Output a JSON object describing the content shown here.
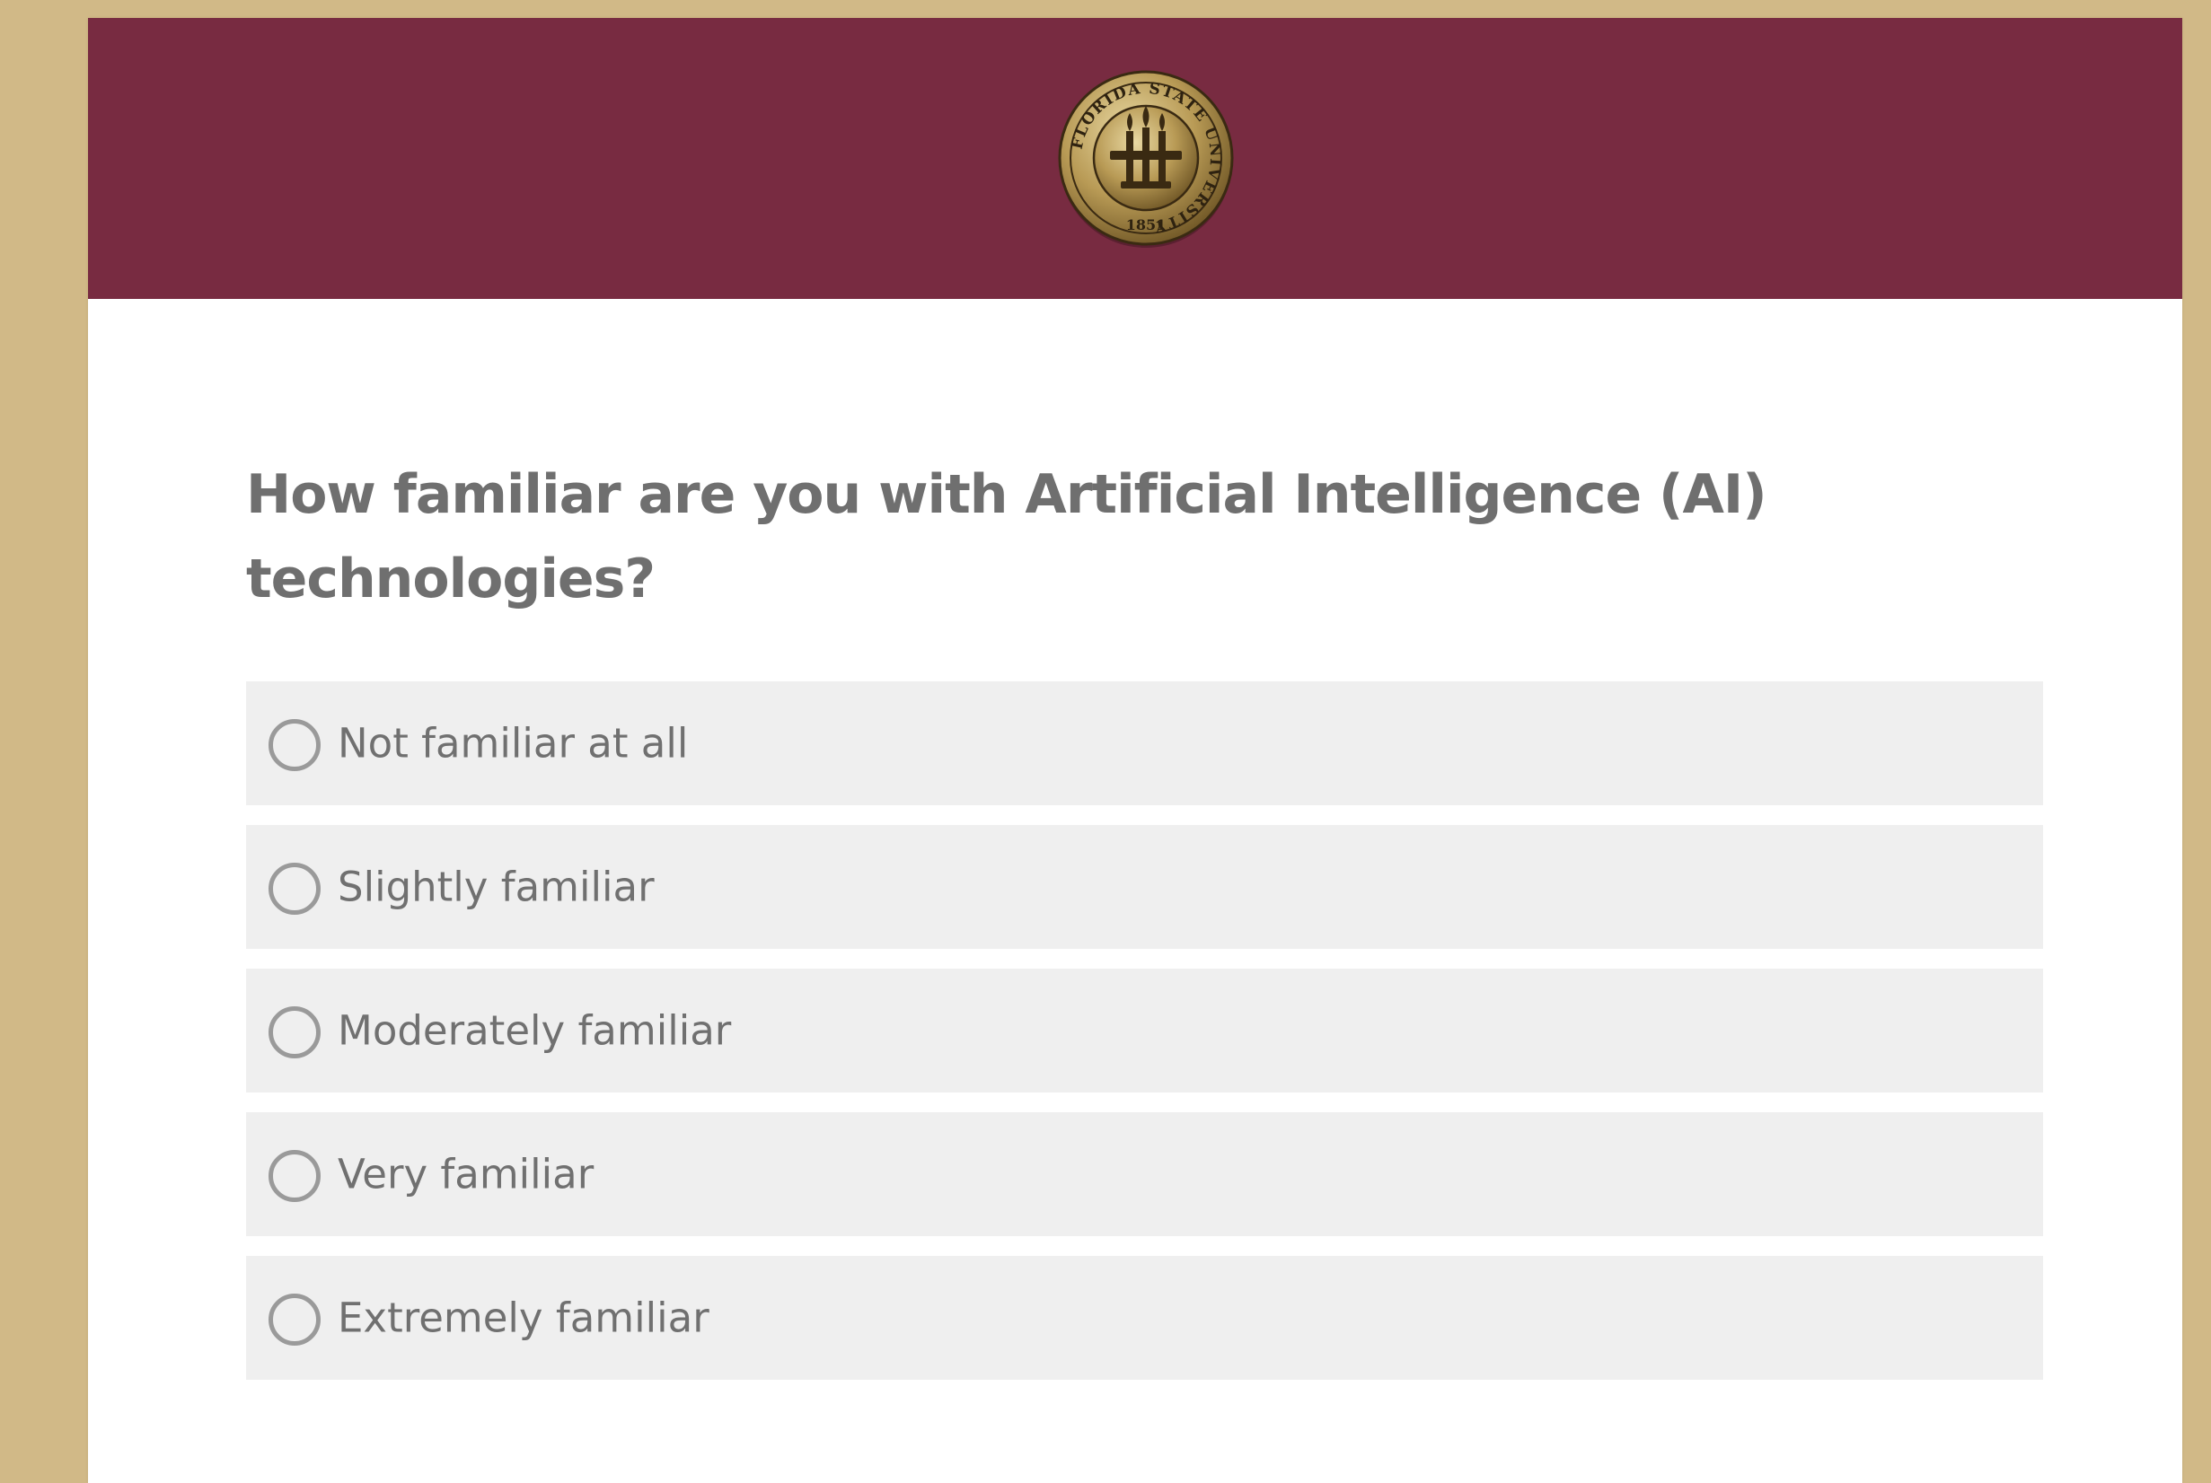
{
  "page": {
    "background_color": "#d1b987",
    "card_color": "#ffffff"
  },
  "header": {
    "background_color": "#782b41",
    "logo": {
      "icon": "university-seal-icon",
      "ring_text": "FLORIDA STATE UNIVERSITY",
      "year": "1851",
      "colors": {
        "gold": "#b89a55",
        "dark": "#3a2a12"
      }
    }
  },
  "question": {
    "text": "How familiar are you with Artificial Intelligence (AI) technologies?",
    "color": "#6f6f6f"
  },
  "options": [
    {
      "label": "Not familiar at all",
      "selected": false
    },
    {
      "label": "Slightly familiar",
      "selected": false
    },
    {
      "label": "Moderately familiar",
      "selected": false
    },
    {
      "label": "Very familiar",
      "selected": false
    },
    {
      "label": "Extremely familiar",
      "selected": false
    }
  ],
  "option_style": {
    "background_color": "#efefef",
    "radio_border_color": "#9a9a9a",
    "label_color": "#707070"
  }
}
